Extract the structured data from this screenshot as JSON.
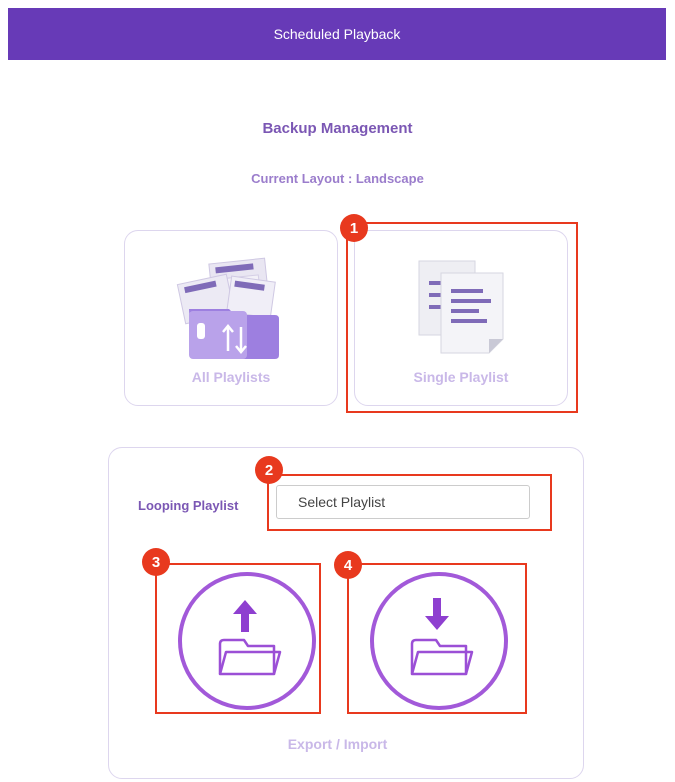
{
  "header": {
    "title": "Scheduled Playback"
  },
  "page": {
    "title": "Backup Management",
    "layout_text": "Current Layout : Landscape"
  },
  "options": {
    "all_playlists": {
      "label": "All Playlists",
      "icon": "folder-transfer-icon"
    },
    "single_playlist": {
      "label": "Single Playlist",
      "icon": "document-copy-icon"
    }
  },
  "looping": {
    "label": "Looping Playlist",
    "select_value": "Select Playlist"
  },
  "actions": {
    "export_icon": "folder-upload-icon",
    "import_icon": "folder-download-icon",
    "label": "Export / Import"
  },
  "callouts": [
    "1",
    "2",
    "3",
    "4"
  ],
  "colors": {
    "accent": "#673ab7",
    "callout": "#e8391e",
    "muted_label": "#c9b8e8"
  }
}
